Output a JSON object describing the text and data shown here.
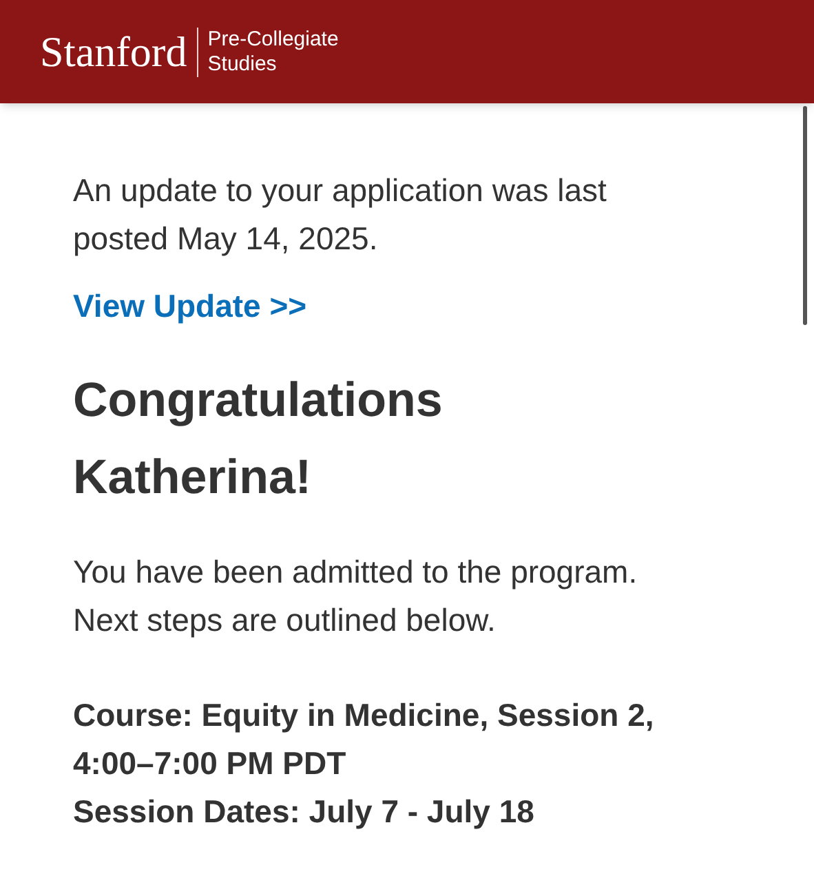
{
  "header": {
    "logo": "Stanford",
    "unit_line_1": "Pre-Collegiate",
    "unit_line_2": "Studies"
  },
  "status_text": "An update to your application was last posted May 14, 2025.",
  "view_update_link": "View Update >>",
  "congrats_heading": "Congratulations Katherina!",
  "admit_text": "You have been admitted to the program. Next steps are outlined below.",
  "course_lines": [
    "Course: Equity in Medicine, Session 2, 4:00–7:00 PM PDT",
    "Session Dates: July 7 - July 18"
  ]
}
